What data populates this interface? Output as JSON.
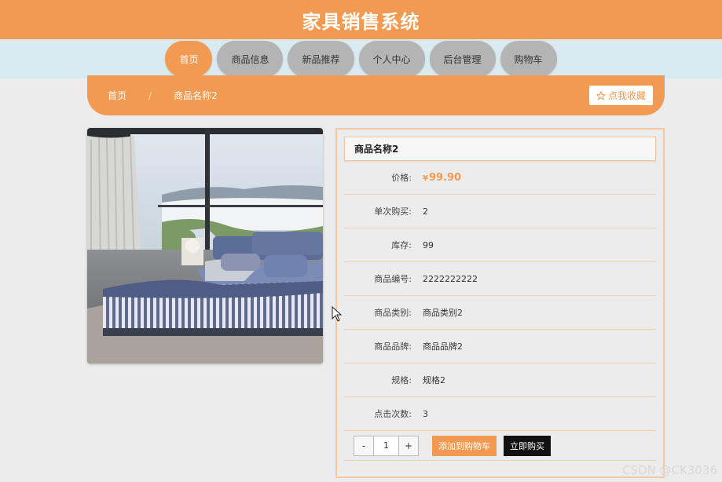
{
  "header": {
    "title": "家具销售系统"
  },
  "nav": {
    "items": [
      {
        "label": "首页",
        "active": true
      },
      {
        "label": "商品信息"
      },
      {
        "label": "新品推荐"
      },
      {
        "label": "个人中心"
      },
      {
        "label": "后台管理"
      },
      {
        "label": "购物车"
      }
    ]
  },
  "breadcrumb": {
    "home": "首页",
    "separator": "/",
    "current": "商品名称2"
  },
  "favorite": {
    "icon": "star-outline-icon",
    "label": "点我收藏"
  },
  "product": {
    "image_icon": "bed-photo",
    "name": "商品名称2",
    "price_symbol": "¥",
    "price": "99.90",
    "fields": [
      {
        "label": "价格:"
      },
      {
        "label": "单次购买:",
        "value": "2"
      },
      {
        "label": "库存:",
        "value": "99"
      },
      {
        "label": "商品编号:",
        "value": "2222222222"
      },
      {
        "label": "商品类别:",
        "value": "商品类别2"
      },
      {
        "label": "商品品牌:",
        "value": "商品品牌2"
      },
      {
        "label": "规格:",
        "value": "规格2"
      },
      {
        "label": "点击次数:",
        "value": "3"
      }
    ]
  },
  "actions": {
    "minus": "-",
    "quantity": "1",
    "plus": "+",
    "add_to_cart": "添加到购物车",
    "buy_now": "立即购买"
  },
  "watermark": "CSDN @CK3036",
  "colors": {
    "accent": "#f29a52",
    "nav_bg": "#d9eaf0",
    "nav_item": "#b4b4b4",
    "buy_btn": "#111111"
  }
}
